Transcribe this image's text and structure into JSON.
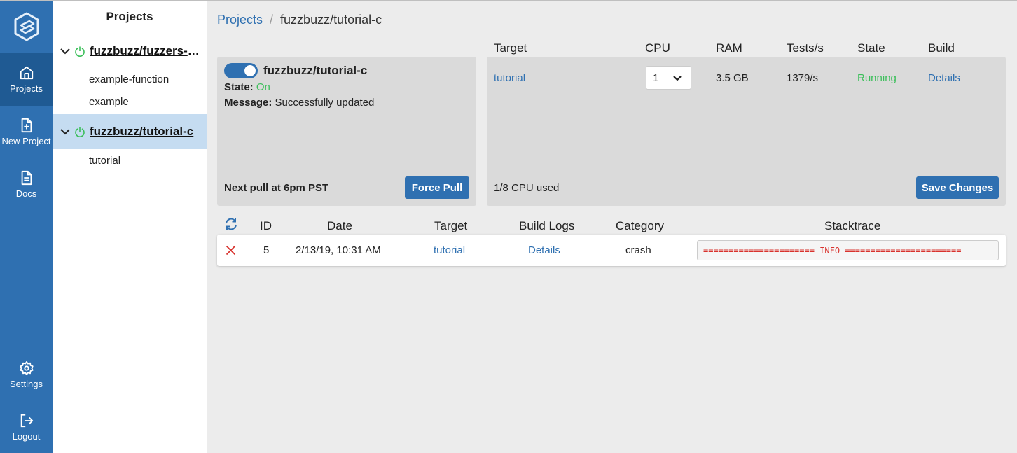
{
  "nav": {
    "logo": "fuzzbuzz-logo",
    "items": [
      {
        "label": "Projects",
        "icon": "home-icon"
      },
      {
        "label": "New Project",
        "icon": "file-plus-icon"
      },
      {
        "label": "Docs",
        "icon": "document-icon"
      },
      {
        "label": "Settings",
        "icon": "gear-icon"
      },
      {
        "label": "Logout",
        "icon": "logout-icon"
      }
    ]
  },
  "projects": {
    "title": "Projects",
    "list": [
      {
        "name": "fuzzbuzz/fuzzers-python",
        "targets": [
          "example-function",
          "example"
        ]
      },
      {
        "name": "fuzzbuzz/tutorial-c",
        "targets": [
          "tutorial"
        ]
      }
    ]
  },
  "breadcrumb": {
    "root": "Projects",
    "separator": "/",
    "current": "fuzzbuzz/tutorial-c"
  },
  "project_panel": {
    "name": "fuzzbuzz/tutorial-c",
    "state_label": "State:",
    "state_value": "On",
    "message_label": "Message:",
    "message_value": "Successfully updated",
    "next_pull": "Next pull at 6pm PST",
    "force_pull": "Force Pull"
  },
  "targets_table": {
    "headers": [
      "Target",
      "CPU",
      "RAM",
      "Tests/s",
      "State",
      "Build"
    ],
    "rows": [
      {
        "target": "tutorial",
        "cpu": "1",
        "ram": "3.5 GB",
        "tests": "1379/s",
        "state": "Running",
        "build": "Details"
      }
    ],
    "cpu_used": "1/8 CPU used",
    "save": "Save Changes"
  },
  "crashes_table": {
    "refresh_icon": "refresh-icon",
    "headers": [
      "ID",
      "Date",
      "Target",
      "Build Logs",
      "Category",
      "Stacktrace"
    ],
    "rows": [
      {
        "status_icon": "close-icon",
        "id": "5",
        "date": "2/13/19, 10:31 AM",
        "target": "tutorial",
        "build_logs": "Details",
        "category": "crash",
        "stacktrace": "====================== INFO ======================="
      }
    ]
  },
  "colors": {
    "nav": "#2f70b1",
    "nav_active": "#1f5a93",
    "accent": "#2f70b1",
    "success": "#3bbf5a",
    "error": "#d8322d",
    "selected": "#c5dcf1"
  }
}
